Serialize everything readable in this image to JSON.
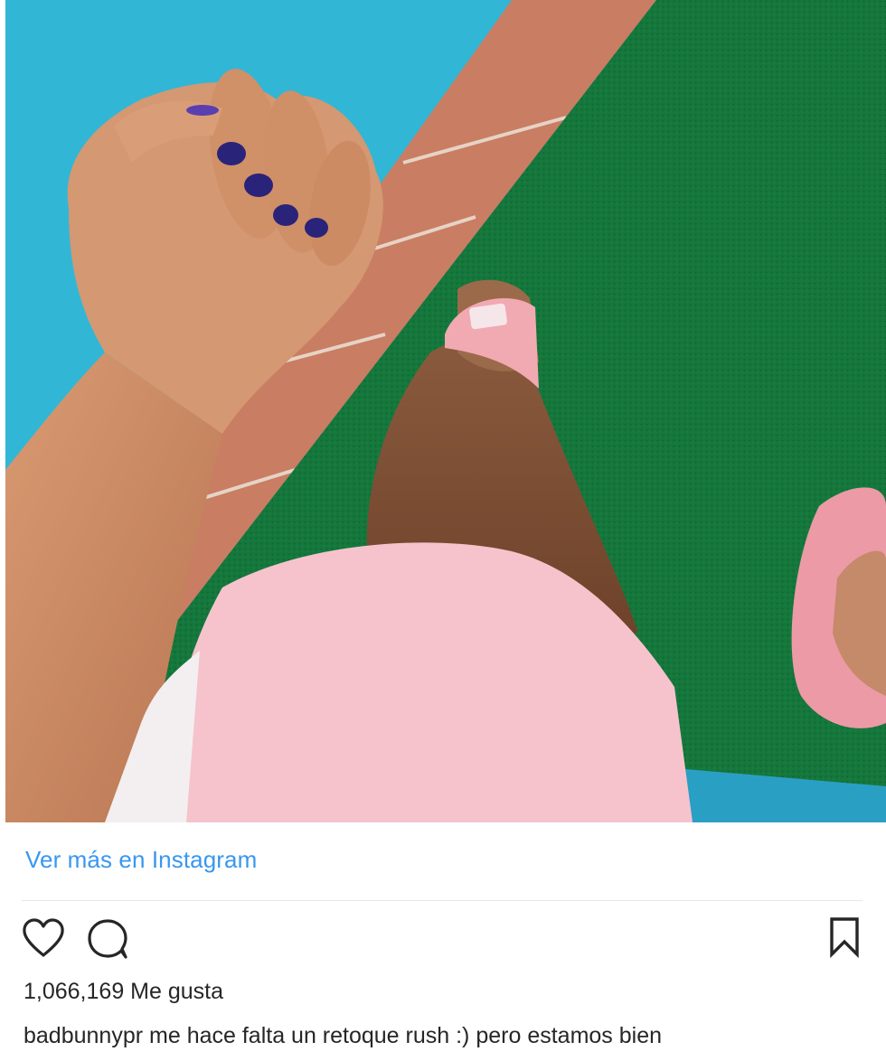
{
  "post": {
    "view_more_label": "Ver más en Instagram",
    "likes_count": "1,066,169",
    "likes_label": "Me gusta",
    "caption_user": "badbunnypr",
    "caption_text": "me hace falta un retoque rush :) pero estamos bien"
  },
  "icons": {
    "like": "heart-icon",
    "comment": "comment-bubble-icon",
    "save": "bookmark-icon"
  },
  "colors": {
    "link": "#3897f0",
    "text": "#262626",
    "divider": "#e6e6e6"
  }
}
